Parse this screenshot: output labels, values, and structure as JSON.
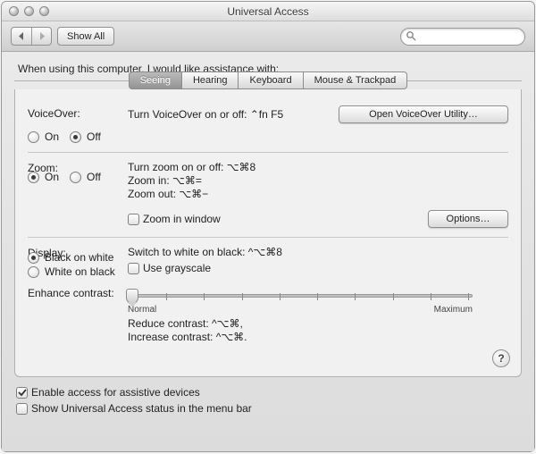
{
  "window": {
    "title": "Universal Access"
  },
  "toolbar": {
    "show_all": "Show All"
  },
  "search": {
    "placeholder": ""
  },
  "intro": "When using this computer, I would like assistance with:",
  "tabs": {
    "seeing": "Seeing",
    "hearing": "Hearing",
    "keyboard": "Keyboard",
    "mouse": "Mouse & Trackpad"
  },
  "voiceover": {
    "label": "VoiceOver:",
    "shortcut": "Turn VoiceOver on or off: ⌃fn F5",
    "on": "On",
    "off": "Off",
    "open_utility": "Open VoiceOver Utility…"
  },
  "zoom": {
    "label": "Zoom:",
    "shortcut_toggle": "Turn zoom on or off: ⌥⌘8",
    "shortcut_in": "Zoom in: ⌥⌘=",
    "shortcut_out": "Zoom out: ⌥⌘−",
    "on": "On",
    "off": "Off",
    "in_window": "Zoom in window",
    "options": "Options…"
  },
  "display": {
    "label": "Display:",
    "shortcut_switch": "Switch to white on black: ^⌥⌘8",
    "black_on_white": "Black on white",
    "white_on_black": "White on black",
    "grayscale": "Use grayscale",
    "enhance": "Enhance contrast:",
    "slider_min": "Normal",
    "slider_max": "Maximum",
    "reduce": "Reduce contrast: ^⌥⌘,",
    "increase": "Increase contrast: ^⌥⌘."
  },
  "help": "?",
  "footer": {
    "assistive": "Enable access for assistive devices",
    "menubar": "Show Universal Access status in the menu bar"
  }
}
